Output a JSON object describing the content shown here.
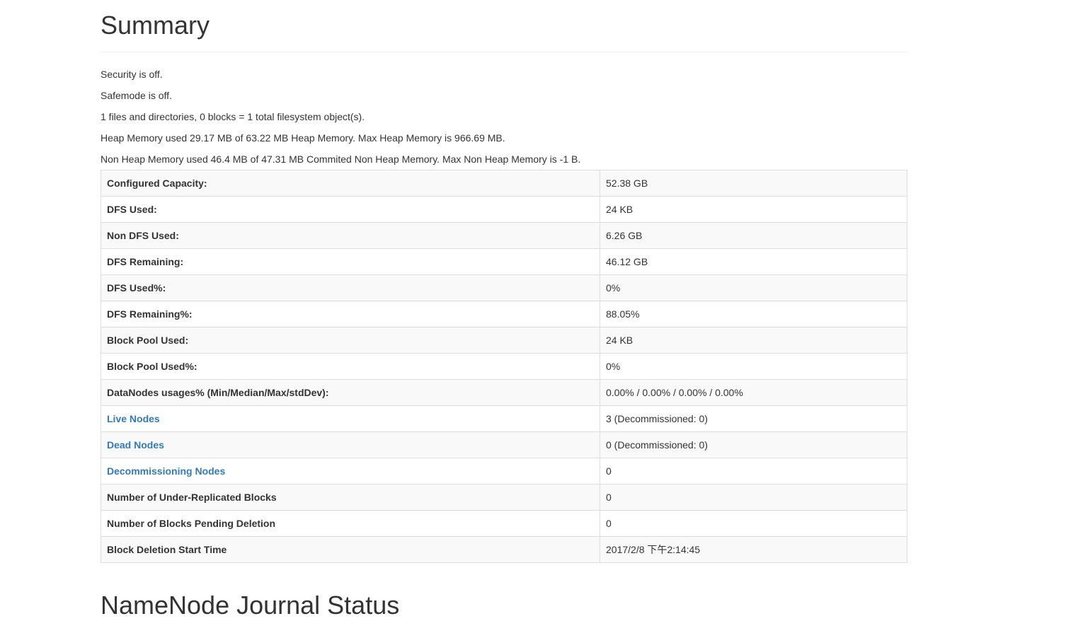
{
  "summary": {
    "title": "Summary",
    "lines": [
      "Security is off.",
      "Safemode is off.",
      "1 files and directories, 0 blocks = 1 total filesystem object(s).",
      "Heap Memory used 29.17 MB of 63.22 MB Heap Memory. Max Heap Memory is 966.69 MB.",
      "Non Heap Memory used 46.4 MB of 47.31 MB Commited Non Heap Memory. Max Non Heap Memory is -1 B."
    ],
    "rows": [
      {
        "label": "Configured Capacity:",
        "value": "52.38 GB"
      },
      {
        "label": "DFS Used:",
        "value": "24 KB"
      },
      {
        "label": "Non DFS Used:",
        "value": "6.26 GB"
      },
      {
        "label": "DFS Remaining:",
        "value": "46.12 GB"
      },
      {
        "label": "DFS Used%:",
        "value": "0%"
      },
      {
        "label": "DFS Remaining%:",
        "value": "88.05%"
      },
      {
        "label": "Block Pool Used:",
        "value": "24 KB"
      },
      {
        "label": "Block Pool Used%:",
        "value": "0%"
      },
      {
        "label": "DataNodes usages% (Min/Median/Max/stdDev):",
        "value": "0.00% / 0.00% / 0.00% / 0.00%"
      },
      {
        "label": "Live Nodes",
        "value": "3 (Decommissioned: 0)"
      },
      {
        "label": "Dead Nodes",
        "value": "0 (Decommissioned: 0)"
      },
      {
        "label": "Decommissioning Nodes",
        "value": "0"
      },
      {
        "label": "Number of Under-Replicated Blocks",
        "value": "0"
      },
      {
        "label": "Number of Blocks Pending Deletion",
        "value": "0"
      },
      {
        "label": "Block Deletion Start Time",
        "value": "2017/2/8 下午2:14:45"
      }
    ]
  },
  "next_section": {
    "title": "NameNode Journal Status"
  },
  "colors": {
    "link": "#337ab7",
    "text": "#333333",
    "border": "#dddddd",
    "stripe": "#f9f9f9"
  }
}
